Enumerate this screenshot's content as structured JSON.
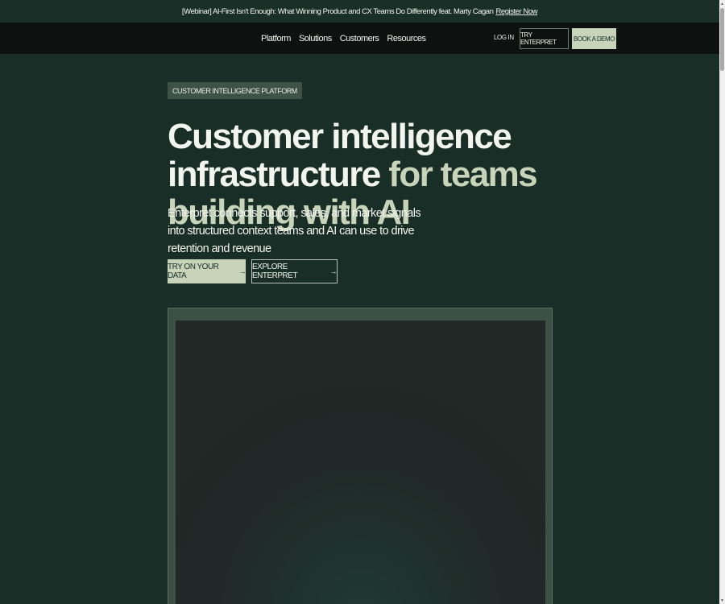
{
  "announcement": {
    "text": "[Webinar] AI-First Isn't Enough: What Winning Product and CX Teams Do Differently feat. Marty Cagan",
    "link": "Register Now"
  },
  "nav": {
    "links": [
      "Platform",
      "Solutions",
      "Customers",
      "Resources"
    ],
    "login": "LOG IN",
    "try_enterpret": "TRY ENTERPRET",
    "book_demo": "BOOK A DEMO"
  },
  "hero": {
    "badge": "CUSTOMER INTELLIGENCE PLATFORM",
    "headline_white": "Customer intelligence infrastructure",
    "headline_green": " for teams building with AI",
    "subline": "Enterpret connects support, sales, and market signals into structured context teams and AI can use to drive retention and revenue",
    "cta_primary": "TRY ON YOUR DATA",
    "cta_secondary": "EXPLORE ENTERPRET",
    "arrow": "→"
  },
  "scrollbar": {
    "up": "▲",
    "down": "▼"
  },
  "colors": {
    "background": "#1a2e28",
    "accent": "#c7d4b9",
    "nav": "#0d110f"
  }
}
